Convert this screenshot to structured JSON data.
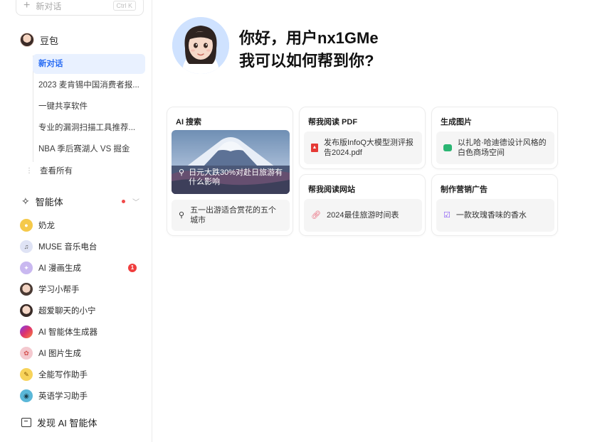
{
  "sidebar": {
    "new_chat": {
      "label": "新对话",
      "shortcut": "Ctrl K"
    },
    "bot_name": "豆包",
    "conversations": [
      {
        "label": "新对话",
        "active": true
      },
      {
        "label": "2023 麦肯锡中国消费者报...",
        "active": false
      },
      {
        "label": "一键共享软件",
        "active": false
      },
      {
        "label": "专业的漏洞扫描工具推荐...",
        "active": false
      },
      {
        "label": "NBA 季后赛湖人 VS 掘金",
        "active": false
      }
    ],
    "view_all": "查看所有",
    "agents_title": "智能体",
    "agents": [
      {
        "label": "奶龙",
        "icon": "milk-dragon-icon",
        "color": "#f5c94a"
      },
      {
        "label": "MUSE 音乐电台",
        "icon": "music-note-icon",
        "color": "#dfe3f5"
      },
      {
        "label": "AI 漫画生成",
        "icon": "comic-icon",
        "color": "#c9b8f0",
        "badge": "1"
      },
      {
        "label": "学习小帮手",
        "icon": "study-helper-icon",
        "color": "#4a3a33"
      },
      {
        "label": "超爱聊天的小宁",
        "icon": "chat-girl-icon",
        "color": "#3a2c28"
      },
      {
        "label": "AI 智能体生成器",
        "icon": "gradient-orb-icon",
        "color": "#e0336b"
      },
      {
        "label": "AI 图片生成",
        "icon": "palette-icon",
        "color": "#f4c9cf"
      },
      {
        "label": "全能写作助手",
        "icon": "pencil-icon",
        "color": "#f7d35a"
      },
      {
        "label": "英语学习助手",
        "icon": "globe-icon",
        "color": "#5ab7d8"
      }
    ],
    "discover": "发现 AI 智能体"
  },
  "main": {
    "greeting_line1": "你好，用户nx1GMe",
    "greeting_line2": "我可以如何帮到你?",
    "cards": {
      "ai_search": {
        "title": "AI 搜索",
        "image_caption": "日元大跌30%对赴日旅游有什么影响",
        "chip": "五一出游适合赏花的五个城市"
      },
      "read_pdf": {
        "title": "帮我阅读 PDF",
        "chip": "发布版InfoQ大模型测评报告2024.pdf"
      },
      "gen_image": {
        "title": "生成图片",
        "chip": "以扎哈·哈迪德设计风格的白色商场空间"
      },
      "read_site": {
        "title": "帮我阅读网站",
        "chip": "2024最佳旅游时间表"
      },
      "marketing": {
        "title": "制作营销广告",
        "chip": "一款玫瑰香味的香水"
      }
    }
  }
}
